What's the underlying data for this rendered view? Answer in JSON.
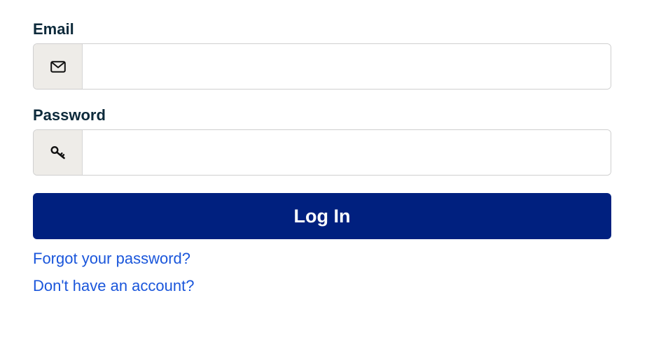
{
  "email": {
    "label": "Email",
    "value": "",
    "icon": "envelope-icon"
  },
  "password": {
    "label": "Password",
    "value": "",
    "icon": "key-icon"
  },
  "login_button": {
    "label": "Log In",
    "color": "#00207f"
  },
  "links": {
    "forgot_password": "Forgot your password?",
    "no_account": "Don't have an account?",
    "color": "#1a56db"
  }
}
